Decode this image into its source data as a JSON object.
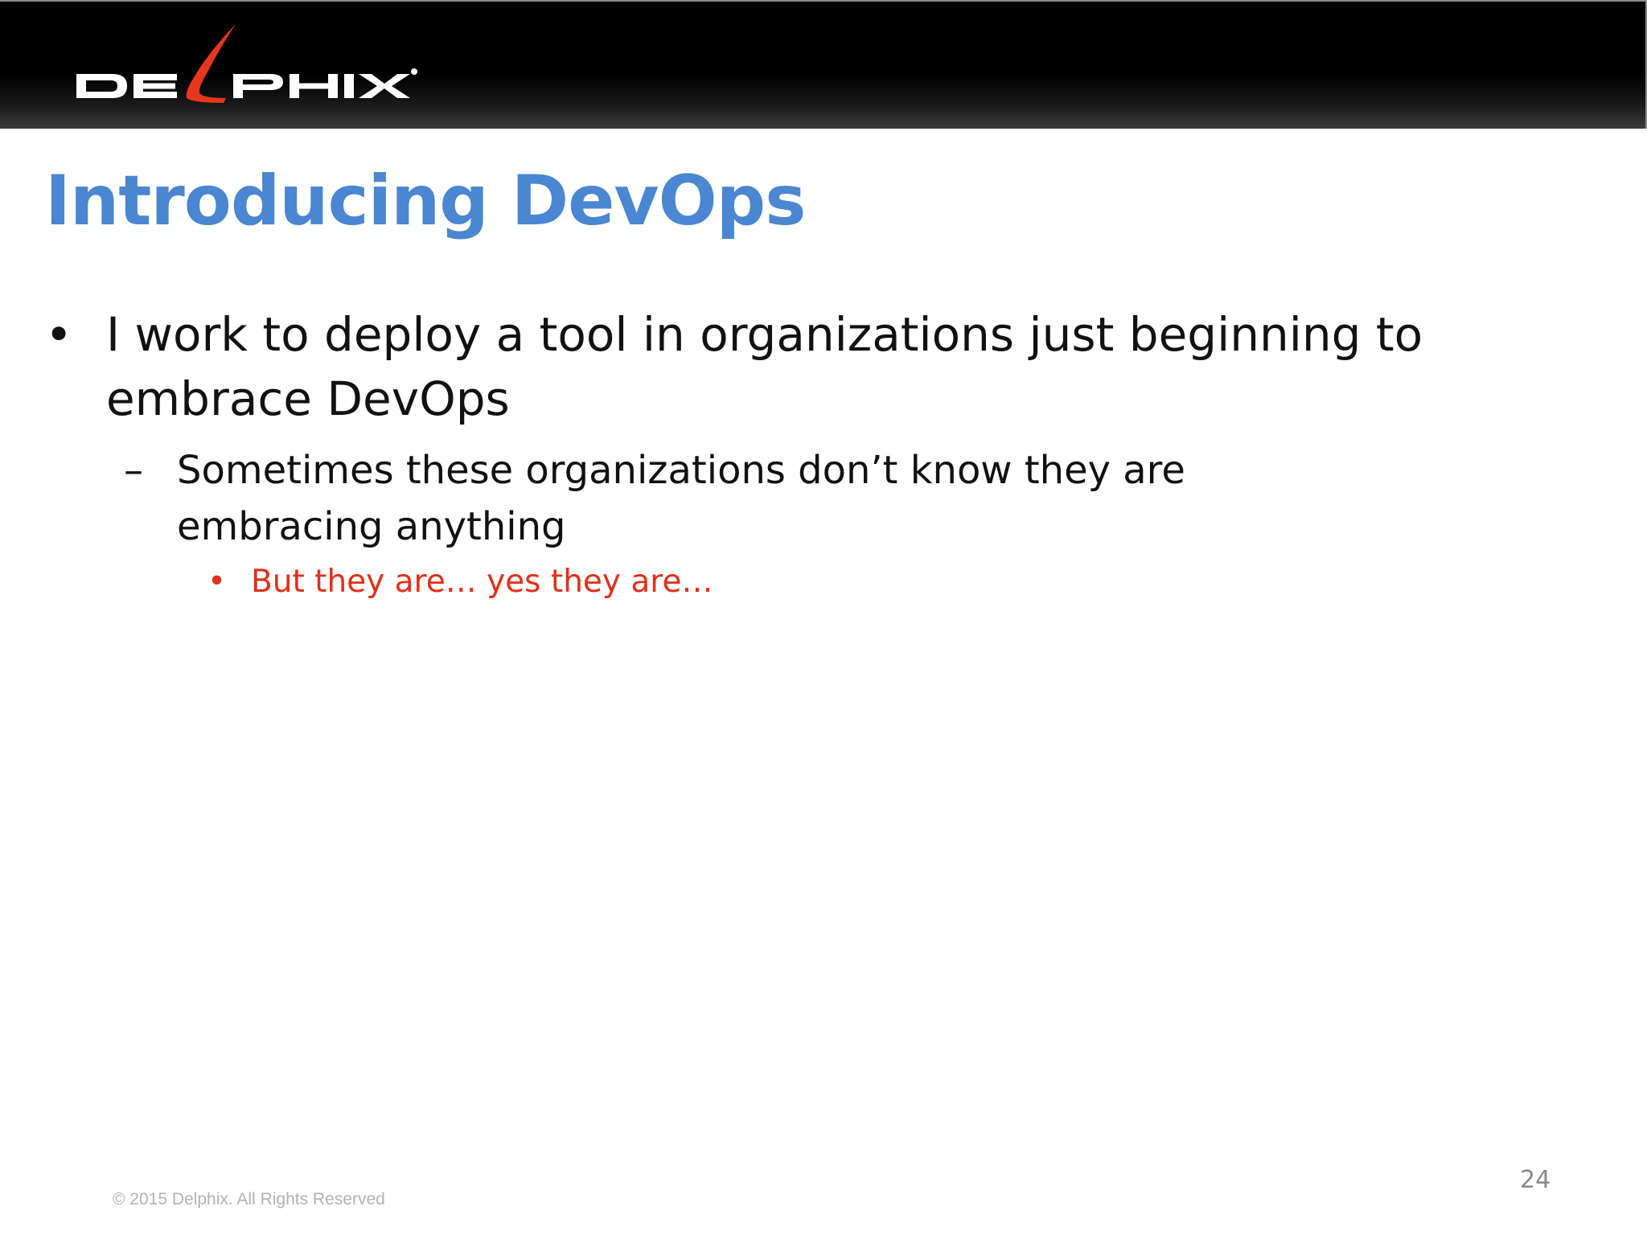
{
  "brand": {
    "logo_text": "DELPHIX®"
  },
  "slide": {
    "title": "Introducing DevOps",
    "bullets": [
      {
        "marker": "•",
        "text": "I work to deploy a tool in organizations just beginning to embrace DevOps",
        "sub": [
          {
            "marker": "–",
            "text": "Sometimes these organizations don’t know they are embracing anything",
            "sub": [
              {
                "marker": "•",
                "text": "But they are… yes they are…"
              }
            ]
          }
        ]
      }
    ],
    "footer": "© 2015 Delphix. All Rights Reserved",
    "page_number": "24"
  },
  "colors": {
    "title": "#4a86d1",
    "highlight": "#e1301a",
    "banner": "#000000",
    "logo_accent": "#e8361e"
  }
}
